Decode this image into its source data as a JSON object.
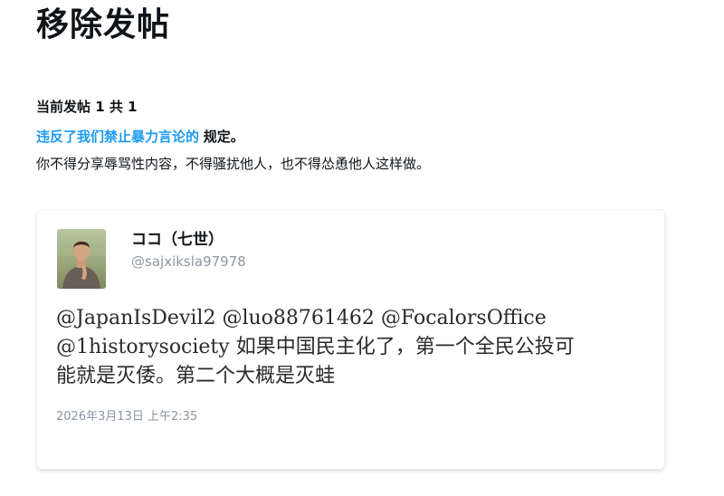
{
  "page": {
    "title": "移除发帖"
  },
  "notice": {
    "count_text": "当前发帖 1 共 1",
    "rule_link": "违反了我们禁止暴力言论的",
    "rule_suffix": "规定。",
    "description": "你不得分享辱骂性内容，不得骚扰他人，也不得怂恿他人这样做。"
  },
  "tweet": {
    "author": {
      "display_name": "ココ（七世）",
      "handle": "@sajxiksla97978",
      "avatar_icon": "user-avatar-photo"
    },
    "mentions": [
      "@JapanIsDevil2",
      "@luo88761462",
      "@FocalorsOffice",
      "@1historysociety"
    ],
    "text_line2_rest": "如果中国民主化了，第一个全民公投可",
    "text_line3": "能就是灭倭。第二个大概是灭蛙",
    "timestamp": "2026年3月13日 上午2:35"
  },
  "colors": {
    "link": "#1d9bf0",
    "text": "#0f1419",
    "muted": "#8c96a0"
  }
}
